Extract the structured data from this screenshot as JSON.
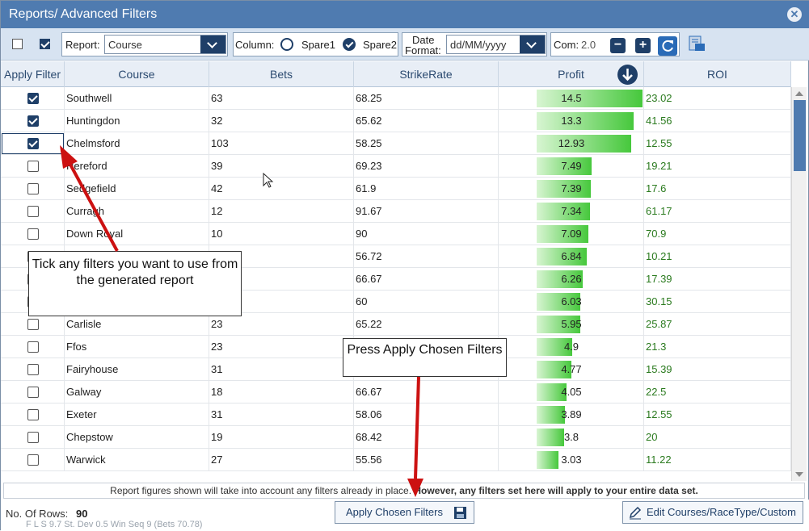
{
  "window": {
    "title": "Reports/ Advanced Filters"
  },
  "toolbar": {
    "report_label": "Report:",
    "report_value": "Course",
    "column_label": "Column:",
    "spare1": "Spare1",
    "spare2": "Spare2",
    "date_label_1": "Date",
    "date_label_2": "Format:",
    "date_value": "dd/MM/yyyy",
    "com_label": "Com:",
    "com_value": "2.0",
    "minus": "−",
    "plus": "+"
  },
  "columns": [
    "Apply Filter",
    "Course",
    "Bets",
    "StrikeRate",
    "Profit",
    "ROI"
  ],
  "rows": [
    {
      "checked": true,
      "course": "Southwell",
      "bets": "63",
      "strike": "68.25",
      "profit": "14.5",
      "profit_num": 14.5,
      "roi": "23.02"
    },
    {
      "checked": true,
      "course": "Huntingdon",
      "bets": "32",
      "strike": "65.62",
      "profit": "13.3",
      "profit_num": 13.3,
      "roi": "41.56"
    },
    {
      "checked": true,
      "course": "Chelmsford",
      "bets": "103",
      "strike": "58.25",
      "profit": "12.93",
      "profit_num": 12.93,
      "roi": "12.55"
    },
    {
      "checked": false,
      "course": "Hereford",
      "bets": "39",
      "strike": "69.23",
      "profit": "7.49",
      "profit_num": 7.49,
      "roi": "19.21"
    },
    {
      "checked": false,
      "course": "Sedgefield",
      "bets": "42",
      "strike": "61.9",
      "profit": "7.39",
      "profit_num": 7.39,
      "roi": "17.6"
    },
    {
      "checked": false,
      "course": "Curragh",
      "bets": "12",
      "strike": "91.67",
      "profit": "7.34",
      "profit_num": 7.34,
      "roi": "61.17"
    },
    {
      "checked": false,
      "course": "Down Royal",
      "bets": "10",
      "strike": "90",
      "profit": "7.09",
      "profit_num": 7.09,
      "roi": "70.9"
    },
    {
      "checked": false,
      "course": "",
      "bets": "",
      "strike": "56.72",
      "profit": "6.84",
      "profit_num": 6.84,
      "roi": "10.21"
    },
    {
      "checked": false,
      "course": "",
      "bets": "",
      "strike": "66.67",
      "profit": "6.26",
      "profit_num": 6.26,
      "roi": "17.39"
    },
    {
      "checked": false,
      "course": "",
      "bets": "",
      "strike": "60",
      "profit": "6.03",
      "profit_num": 6.03,
      "roi": "30.15"
    },
    {
      "checked": false,
      "course": "Carlisle",
      "bets": "23",
      "strike": "65.22",
      "profit": "5.95",
      "profit_num": 5.95,
      "roi": "25.87"
    },
    {
      "checked": false,
      "course": "Ffos",
      "bets": "23",
      "strike": "",
      "profit": "4.9",
      "profit_num": 4.9,
      "roi": "21.3"
    },
    {
      "checked": false,
      "course": "Fairyhouse",
      "bets": "31",
      "strike": "",
      "profit": "4.77",
      "profit_num": 4.77,
      "roi": "15.39"
    },
    {
      "checked": false,
      "course": "Galway",
      "bets": "18",
      "strike": "66.67",
      "profit": "4.05",
      "profit_num": 4.05,
      "roi": "22.5"
    },
    {
      "checked": false,
      "course": "Exeter",
      "bets": "31",
      "strike": "58.06",
      "profit": "3.89",
      "profit_num": 3.89,
      "roi": "12.55"
    },
    {
      "checked": false,
      "course": "Chepstow",
      "bets": "19",
      "strike": "68.42",
      "profit": "3.8",
      "profit_num": 3.8,
      "roi": "20"
    },
    {
      "checked": false,
      "course": "Warwick",
      "bets": "27",
      "strike": "55.56",
      "profit": "3.03",
      "profit_num": 3.03,
      "roi": "11.22"
    }
  ],
  "footer": {
    "note_a": "Report figures shown will take into account any filters already in place. ",
    "note_b": "However, any filters set here will apply to your entire data set.",
    "rows_label": "No. Of Rows:",
    "rows_value": "90",
    "apply_button": "Apply Chosen Filters",
    "edit_button": "Edit Courses/RaceType/Custom"
  },
  "background_text": "F L S      9.7      St. Dev      0.5      Win Seq      9 (Bets 70.78)",
  "callouts": {
    "tick": "Tick any filters you want to use from the generated report",
    "press": "Press Apply Chosen Filters"
  },
  "colors": {
    "title_bar": "#4f7bb0",
    "accent": "#1f3f68",
    "profit_bar": "#46c83c",
    "roi_text": "#2a7a1e",
    "arrow": "#cc1111"
  }
}
